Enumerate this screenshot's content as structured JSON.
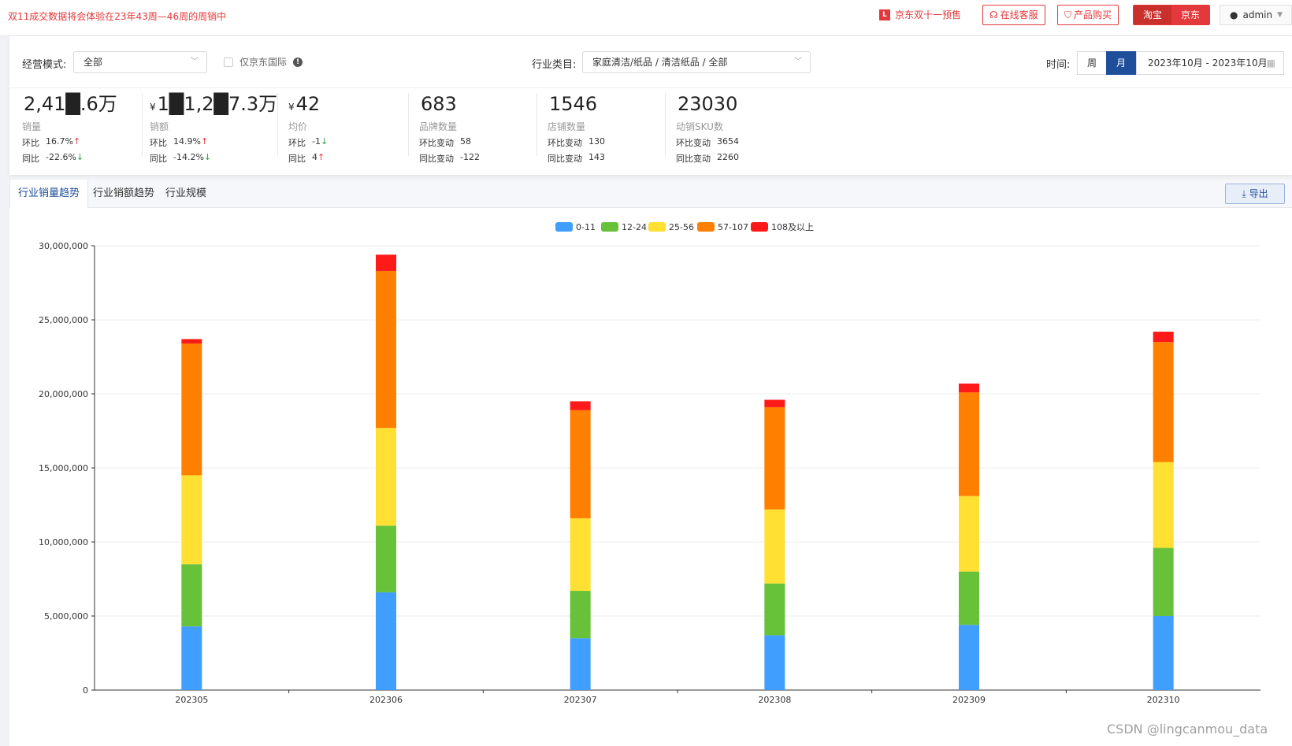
{
  "topbar": {
    "notice": "双11成交数据将会体验在23年43周—46周的周销中",
    "promo_label": "京东双十一预售",
    "service_label": "在线客服",
    "buy_label": "产品购买",
    "taobao_label": "淘宝",
    "jd_label": "京东",
    "user_name": "admin"
  },
  "filters": {
    "mode_label": "经营模式:",
    "mode_value": "全部",
    "intl_label": "仅京东国际",
    "category_label": "行业类目:",
    "category_value": "家庭清洁/纸品 / 清洁纸品 / 全部",
    "time_label": "时间:",
    "week_label": "周",
    "month_label": "月",
    "date_range": "2023年10月 - 2023年10月"
  },
  "metrics": [
    {
      "value": "2,41█.6万",
      "currency": "",
      "name": "销量",
      "r1_label": "环比",
      "r1_value": "16.7%",
      "r1_dir": "↑",
      "r2_label": "同比",
      "r2_value": "-22.6%",
      "r2_dir": "↓"
    },
    {
      "value": "1█1,2█7.3万",
      "currency": "¥",
      "name": "销额",
      "r1_label": "环比",
      "r1_value": "14.9%",
      "r1_dir": "↑",
      "r2_label": "同比",
      "r2_value": "-14.2%",
      "r2_dir": "↓"
    },
    {
      "value": "42",
      "currency": "¥",
      "name": "均价",
      "r1_label": "环比",
      "r1_value": "-1",
      "r1_dir": "↓",
      "r2_label": "同比",
      "r2_value": "4",
      "r2_dir": "↑"
    },
    {
      "value": "683",
      "currency": "",
      "name": "品牌数量",
      "r1_label": "环比变动",
      "r1_value": "58",
      "r1_dir": "",
      "r2_label": "同比变动",
      "r2_value": "-122",
      "r2_dir": ""
    },
    {
      "value": "1546",
      "currency": "",
      "name": "店铺数量",
      "r1_label": "环比变动",
      "r1_value": "130",
      "r1_dir": "",
      "r2_label": "同比变动",
      "r2_value": "143",
      "r2_dir": ""
    },
    {
      "value": "23030",
      "currency": "",
      "name": "动销SKU数",
      "r1_label": "环比变动",
      "r1_value": "3654",
      "r1_dir": "",
      "r2_label": "同比变动",
      "r2_value": "2260",
      "r2_dir": ""
    }
  ],
  "tabs": [
    {
      "label": "行业销量趋势"
    },
    {
      "label": "行业销额趋势"
    },
    {
      "label": "行业规模"
    }
  ],
  "export_label": "导出",
  "watermark": "CSDN @lingcanmou_data",
  "colors": {
    "accent": "#1f4e9a",
    "alert": "#e4393c",
    "series": [
      "#409eff",
      "#67c23a",
      "#ffe033",
      "#ff7f00",
      "#ff1a1a"
    ]
  },
  "chart_data": {
    "type": "bar",
    "stacked": true,
    "categories": [
      "202305",
      "202306",
      "202307",
      "202308",
      "202309",
      "202310"
    ],
    "series": [
      {
        "name": "0-11",
        "values": [
          4300000,
          6600000,
          3500000,
          3700000,
          4400000,
          5000000
        ]
      },
      {
        "name": "12-24",
        "values": [
          4200000,
          4500000,
          3200000,
          3500000,
          3600000,
          4600000
        ]
      },
      {
        "name": "25-56",
        "values": [
          6000000,
          6600000,
          4900000,
          5000000,
          5100000,
          5800000
        ]
      },
      {
        "name": "57-107",
        "values": [
          8900000,
          10600000,
          7300000,
          6900000,
          7000000,
          8100000
        ]
      },
      {
        "name": "108及以上",
        "values": [
          300000,
          1100000,
          600000,
          500000,
          600000,
          700000
        ]
      }
    ],
    "ylim": [
      0,
      30000000
    ],
    "yticks": [
      "0",
      "5,000,000",
      "10,000,000",
      "15,000,000",
      "20,000,000",
      "25,000,000",
      "30,000,000"
    ],
    "legend_position": "top-center",
    "grid": true
  }
}
